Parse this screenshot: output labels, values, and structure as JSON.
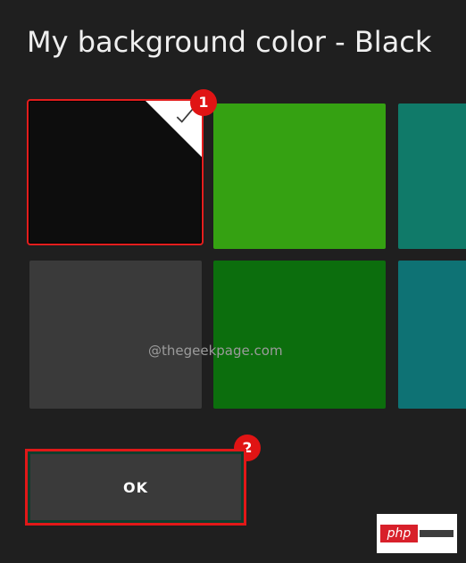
{
  "page": {
    "title": "My background color - Black"
  },
  "colors": {
    "background": "#1f1f1f",
    "highlight": "#e01414",
    "button_bg": "#3a3a3a"
  },
  "swatches": [
    {
      "name": "black",
      "color": "#0d0d0d",
      "selected": true
    },
    {
      "name": "green-light",
      "color": "#35a112",
      "selected": false
    },
    {
      "name": "teal",
      "color": "#107a69",
      "selected": false
    },
    {
      "name": "gray",
      "color": "#3a3a3a",
      "selected": false
    },
    {
      "name": "green-dark",
      "color": "#0c6e0d",
      "selected": false
    },
    {
      "name": "teal-dark",
      "color": "#0e7274",
      "selected": false
    }
  ],
  "badges": {
    "one": "1",
    "two": "2"
  },
  "ok_button": {
    "label": "OK"
  },
  "watermark": {
    "text": "@thegeekpage.com"
  },
  "logo": {
    "text": "php"
  },
  "icons": {
    "check": "check-icon"
  }
}
